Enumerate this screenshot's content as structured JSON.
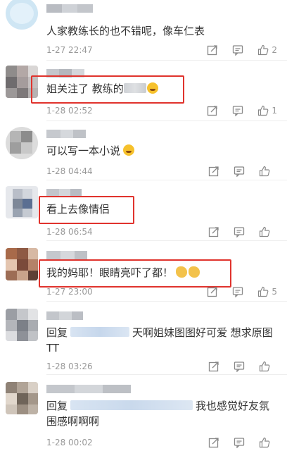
{
  "comments": [
    {
      "text": "人家教练长的也不错呢，像车仁表",
      "time": "1-27 22:47",
      "likes": "2",
      "highlighted": false
    },
    {
      "text": "姐关注了 教练的",
      "time": "1-28 02:52",
      "likes": "1",
      "highlighted": true,
      "emoji": "laugh-emoji"
    },
    {
      "text": "可以写一本小说",
      "time": "1-28 04:44",
      "likes": "",
      "highlighted": false,
      "emoji": "laugh-emoji"
    },
    {
      "text": "看上去像情侣",
      "time": "1-28 06:54",
      "likes": "",
      "highlighted": true
    },
    {
      "text": "我的妈耶！眼睛亮吓了都！",
      "time": "1-27 23:00",
      "likes": "5",
      "highlighted": true,
      "emoji": "pray-hands-emoji"
    },
    {
      "reply_prefix": "回复",
      "text_line1": "天啊姐妹图图好可爱 想求原图",
      "text_line2": "TT",
      "time": "1-28 03:26",
      "likes": "",
      "highlighted": false
    },
    {
      "reply_prefix": "回复",
      "text_line1": "我也感觉好友氛",
      "text_line2": "围感啊啊啊",
      "time": "1-28 00:02",
      "likes": "",
      "highlighted": false
    }
  ],
  "colors": {
    "highlight_border": "#e0332d",
    "meta_gray": "#999999",
    "body_text": "#333333"
  }
}
